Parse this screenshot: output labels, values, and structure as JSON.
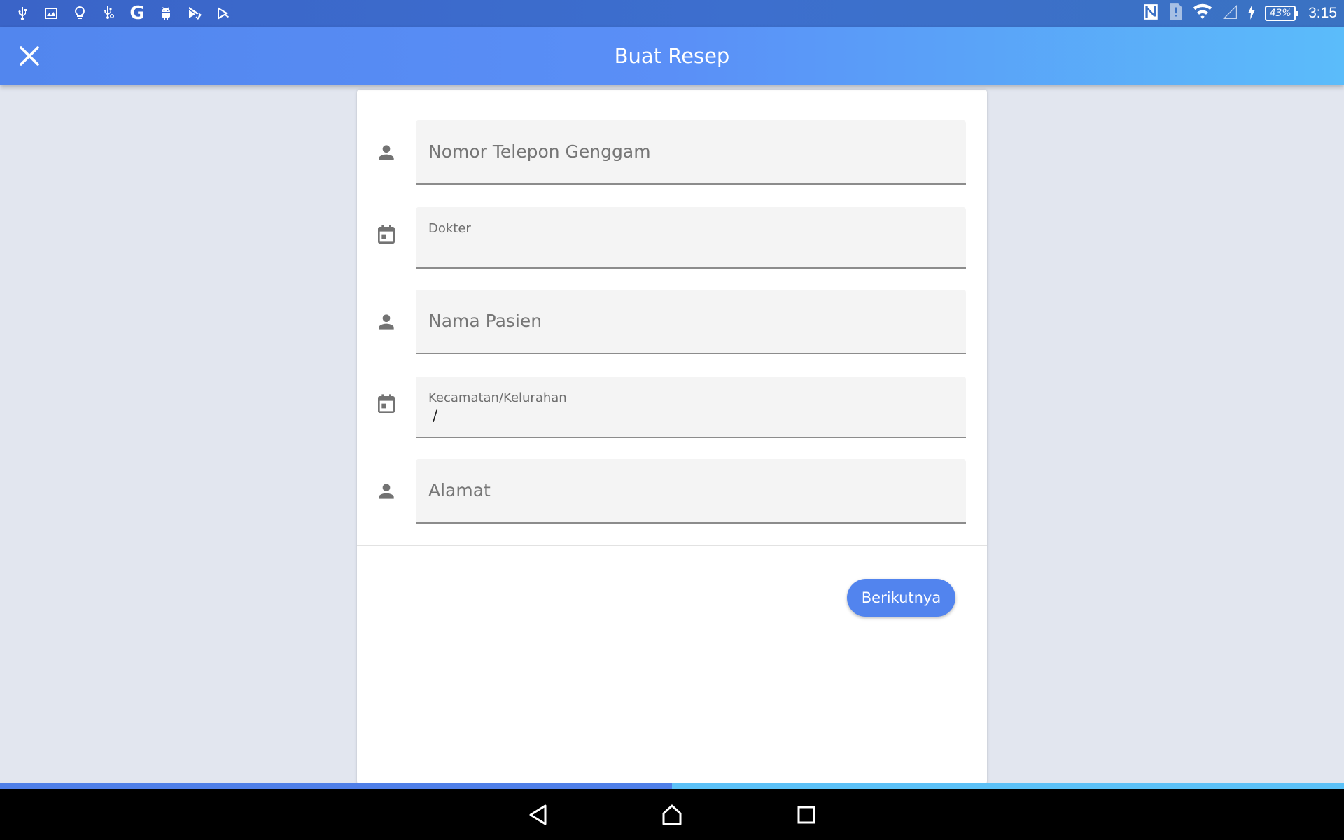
{
  "status_bar": {
    "left_icons": [
      "usb-icon",
      "image-icon",
      "lightbulb-icon",
      "usb-debug-icon",
      "google-icon",
      "android-icon",
      "play-store-check-icon",
      "play-store-icon"
    ],
    "google_glyph": "G",
    "battery": "43%",
    "time": "3:15",
    "right_icons": [
      "nfc-icon",
      "sim-alert-icon",
      "wifi-icon",
      "signal-icon",
      "charging-icon",
      "battery-icon"
    ]
  },
  "app_bar": {
    "title": "Buat Resep",
    "close_icon": "close-icon",
    "gradient_start": "#5286ee",
    "gradient_end": "#5bbcfa"
  },
  "form": {
    "fields": [
      {
        "icon": "person-icon",
        "placeholder": "Nomor Telepon Genggam"
      },
      {
        "icon": "calendar-icon",
        "label": "Dokter",
        "value": ""
      },
      {
        "icon": "person-icon",
        "placeholder": "Nama Pasien"
      },
      {
        "icon": "calendar-icon",
        "label": "Kecamatan/Kelurahan",
        "value": "/"
      },
      {
        "icon": "person-icon",
        "placeholder": "Alamat"
      }
    ],
    "next_button": "Berikutnya",
    "accent_color": "#5284ee"
  },
  "progress": {
    "fraction": 0.5,
    "fill_color": "#4f7fe8",
    "track_color": "#5cc1f7"
  },
  "nav_bar": {
    "buttons": [
      "back-icon",
      "home-icon",
      "recents-icon"
    ]
  }
}
